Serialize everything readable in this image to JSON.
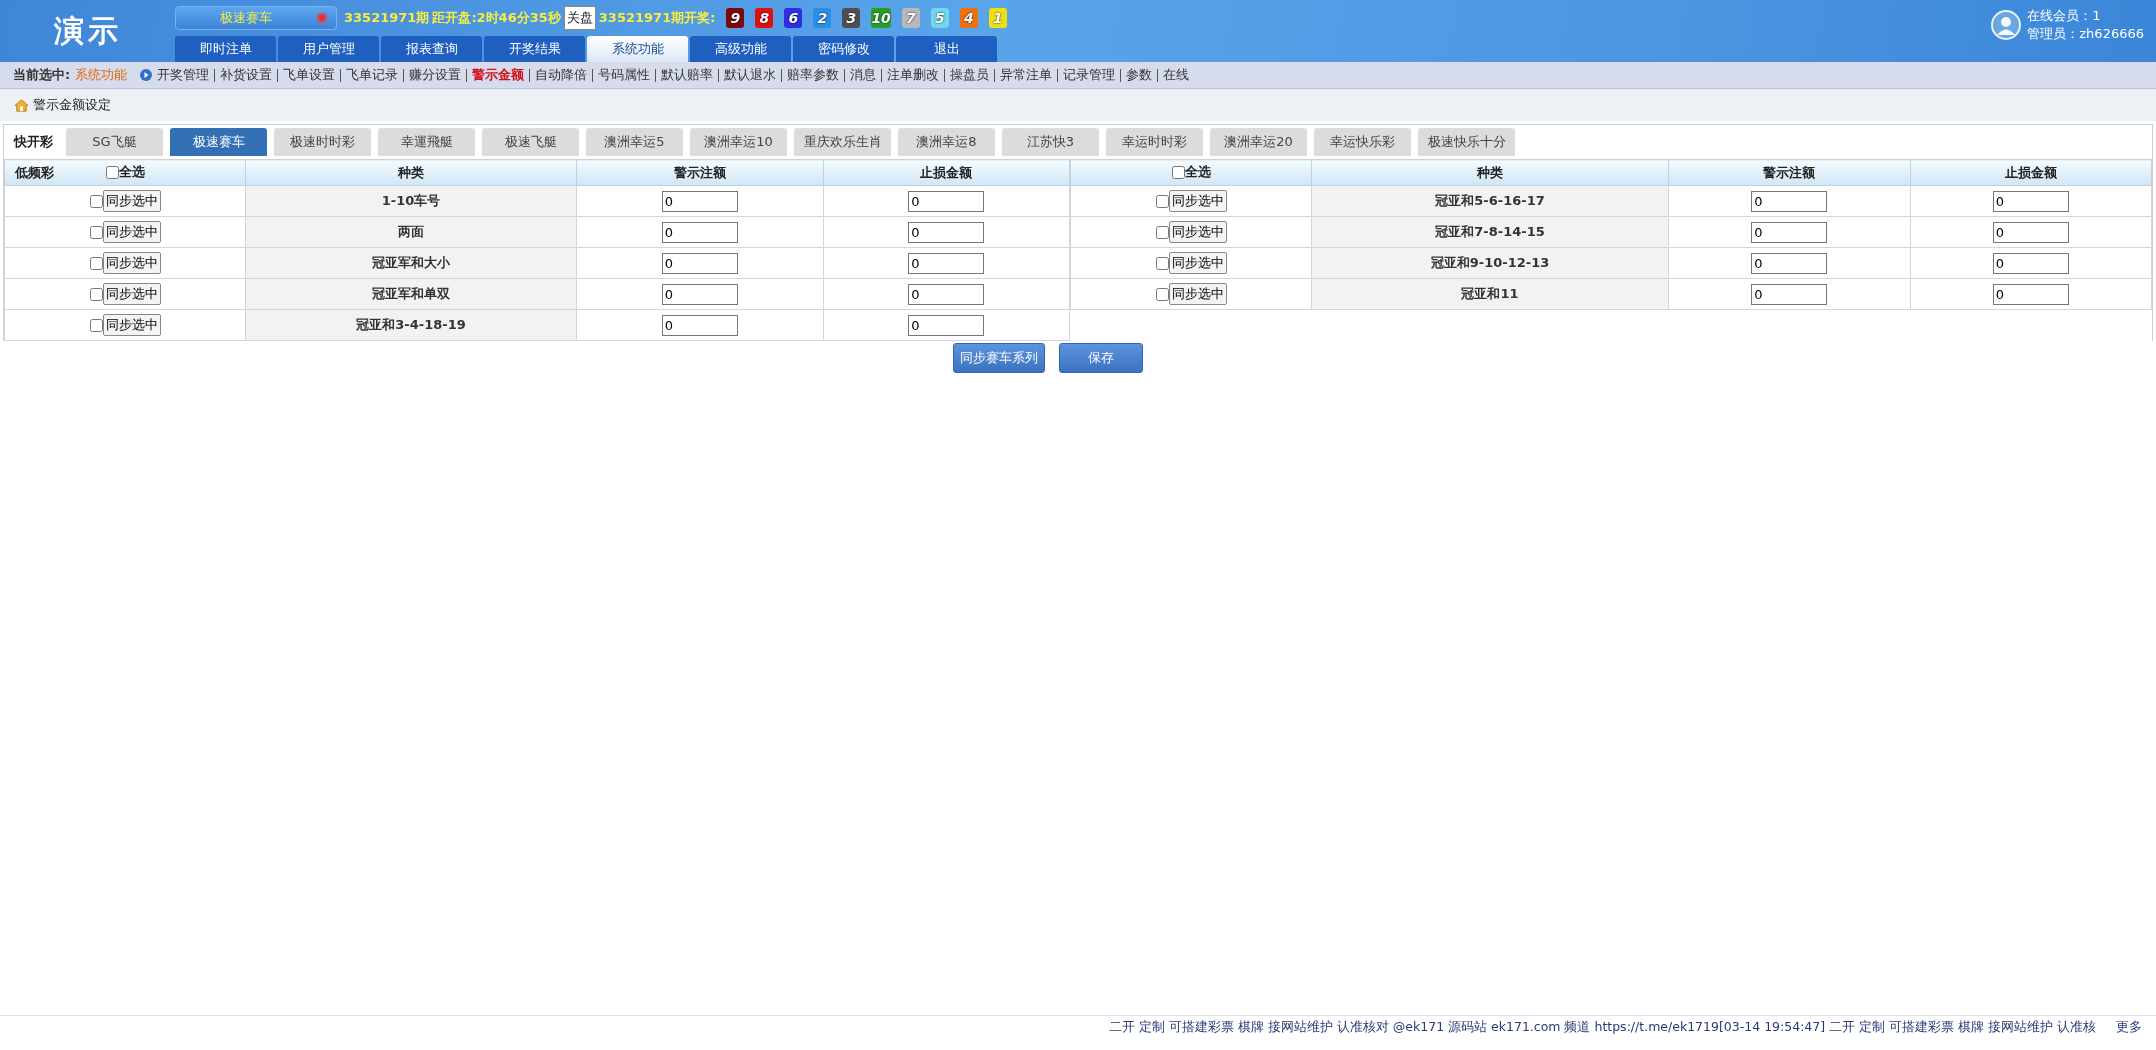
{
  "header": {
    "logo": "演示",
    "game_selector": "极速赛车",
    "period": "33521971期",
    "countdown": "距开盘:2时46分35秒",
    "status_badge": "关盘",
    "last_draw_label": "33521971期开奖:",
    "balls": [
      {
        "number": "9",
        "color": "#7a0a0a"
      },
      {
        "number": "8",
        "color": "#e01010"
      },
      {
        "number": "6",
        "color": "#2f2fe0"
      },
      {
        "number": "2",
        "color": "#2a8ee8"
      },
      {
        "number": "3",
        "color": "#4f4f4f"
      },
      {
        "number": "10",
        "color": "#28a028"
      },
      {
        "number": "7",
        "color": "#b8b8b8"
      },
      {
        "number": "5",
        "color": "#6fd8ec"
      },
      {
        "number": "4",
        "color": "#f07010"
      },
      {
        "number": "1",
        "color": "#f0e010"
      }
    ],
    "nav_tabs": [
      {
        "label": "即时注单",
        "selected": false
      },
      {
        "label": "用户管理",
        "selected": false
      },
      {
        "label": "报表查询",
        "selected": false
      },
      {
        "label": "开奖结果",
        "selected": false
      },
      {
        "label": "系统功能",
        "selected": true
      },
      {
        "label": "高级功能",
        "selected": false
      },
      {
        "label": "密码修改",
        "selected": false
      },
      {
        "label": "退出",
        "selected": false
      }
    ],
    "online_members": "在线会员：1",
    "admin": "管理员：zh626666"
  },
  "subnav": {
    "label": "当前选中:",
    "current": "系统功能",
    "items": [
      {
        "label": "开奖管理",
        "selected": false
      },
      {
        "label": "补货设置",
        "selected": false
      },
      {
        "label": "飞单设置",
        "selected": false
      },
      {
        "label": "飞单记录",
        "selected": false
      },
      {
        "label": "赚分设置",
        "selected": false
      },
      {
        "label": "警示金额",
        "selected": true
      },
      {
        "label": "自动降倍",
        "selected": false
      },
      {
        "label": "号码属性",
        "selected": false
      },
      {
        "label": "默认赔率",
        "selected": false
      },
      {
        "label": "默认退水",
        "selected": false
      },
      {
        "label": "赔率参数",
        "selected": false
      },
      {
        "label": "消息",
        "selected": false
      },
      {
        "label": "注单删改",
        "selected": false
      },
      {
        "label": "操盘员",
        "selected": false
      },
      {
        "label": "异常注单",
        "selected": false
      },
      {
        "label": "记录管理",
        "selected": false
      },
      {
        "label": "参数",
        "selected": false
      },
      {
        "label": "在线",
        "selected": false
      }
    ]
  },
  "breadcrumb": "警示金额设定",
  "fast_label": "快开彩",
  "game_tabs": [
    {
      "label": "SG飞艇",
      "selected": false
    },
    {
      "label": "极速赛车",
      "selected": true
    },
    {
      "label": "极速时时彩",
      "selected": false
    },
    {
      "label": "幸運飛艇",
      "selected": false
    },
    {
      "label": "极速飞艇",
      "selected": false
    },
    {
      "label": "澳洲幸运5",
      "selected": false
    },
    {
      "label": "澳洲幸运10",
      "selected": false
    },
    {
      "label": "重庆欢乐生肖",
      "selected": false
    },
    {
      "label": "澳洲幸运8",
      "selected": false
    },
    {
      "label": "江苏快3",
      "selected": false
    },
    {
      "label": "幸运时时彩",
      "selected": false
    },
    {
      "label": "澳洲幸运20",
      "selected": false
    },
    {
      "label": "幸运快乐彩",
      "selected": false
    },
    {
      "label": "极速快乐十分",
      "selected": false
    }
  ],
  "slow_label": "低频彩",
  "tables": [
    {
      "columns": [
        "全选",
        "种类",
        "警示注额",
        "止损金额"
      ],
      "select_all_checked": false,
      "rows": [
        {
          "sync_button": "同步选中",
          "checked": false,
          "type": "1-10车号",
          "warn_amount": "0",
          "stop_amount": "0"
        },
        {
          "sync_button": "同步选中",
          "checked": false,
          "type": "两面",
          "warn_amount": "0",
          "stop_amount": "0"
        },
        {
          "sync_button": "同步选中",
          "checked": false,
          "type": "冠亚军和大小",
          "warn_amount": "0",
          "stop_amount": "0"
        },
        {
          "sync_button": "同步选中",
          "checked": false,
          "type": "冠亚军和单双",
          "warn_amount": "0",
          "stop_amount": "0"
        },
        {
          "sync_button": "同步选中",
          "checked": false,
          "type": "冠亚和3-4-18-19",
          "warn_amount": "0",
          "stop_amount": "0"
        }
      ]
    },
    {
      "columns": [
        "全选",
        "种类",
        "警示注额",
        "止损金额"
      ],
      "select_all_checked": false,
      "rows": [
        {
          "sync_button": "同步选中",
          "checked": false,
          "type": "冠亚和5-6-16-17",
          "warn_amount": "0",
          "stop_amount": "0"
        },
        {
          "sync_button": "同步选中",
          "checked": false,
          "type": "冠亚和7-8-14-15",
          "warn_amount": "0",
          "stop_amount": "0"
        },
        {
          "sync_button": "同步选中",
          "checked": false,
          "type": "冠亚和9-10-12-13",
          "warn_amount": "0",
          "stop_amount": "0"
        },
        {
          "sync_button": "同步选中",
          "checked": false,
          "type": "冠亚和11",
          "warn_amount": "0",
          "stop_amount": "0"
        }
      ]
    }
  ],
  "actions": [
    "同步赛车系列",
    "保存"
  ],
  "footer": {
    "marquee": "二开 定制 可搭建彩票 棋牌 接网站维护 认准核对 @ek171 源码站 ek171.com 频道 https://t.me/ek1719[03-14 19:54:47] 二开 定制 可搭建彩票 棋牌 接网站维护 认准核",
    "more": "更多"
  }
}
